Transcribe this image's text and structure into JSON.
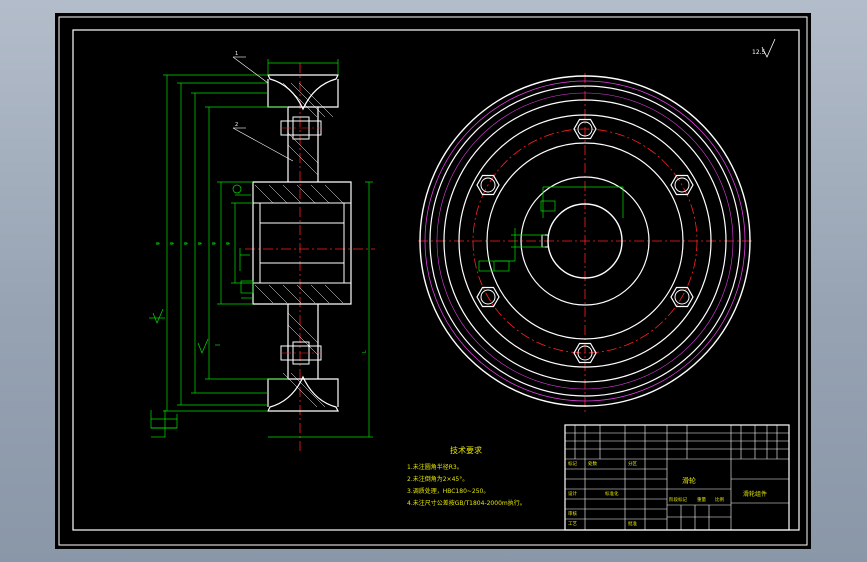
{
  "drawing": {
    "roughness_note": "12.5",
    "part_labels": [
      "1",
      "2"
    ],
    "tech_req": {
      "title": "技术要求",
      "items": [
        "1.未注圆角半径R3。",
        "2.未注倒角为2×45°。",
        "3.调质处理，HBC180~250。",
        "4.未注尺寸公差按GB/T1804-2000m执行。"
      ]
    },
    "title_block": {
      "part_name": "滑轮",
      "drawing_no": "滑轮组件",
      "cells": [
        "标记",
        "处数",
        "分区",
        "设计",
        "标准化",
        "审核",
        "工艺",
        "批准",
        "阶段标记",
        "重量",
        "比例"
      ]
    },
    "colors": {
      "line": "#ffffff",
      "dim": "#00e000",
      "center": "#ff2020",
      "thread": "#e040e0",
      "text": "#e6e600"
    }
  }
}
